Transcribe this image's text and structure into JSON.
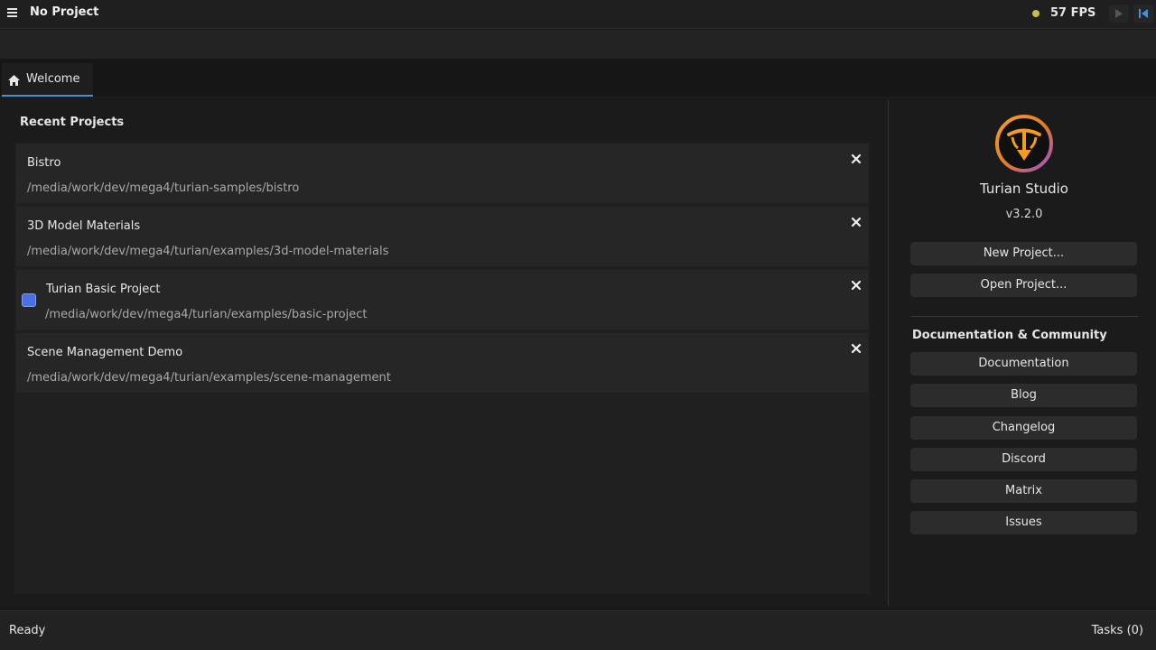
{
  "titlebar": {
    "project_title": "No Project",
    "fps": "57 FPS",
    "fps_dot_color": "#c9bd4a"
  },
  "tabs": [
    {
      "label": "Welcome",
      "icon": "home-icon",
      "active": true
    }
  ],
  "recent": {
    "header": "Recent Projects",
    "projects": [
      {
        "name": "Bistro",
        "path": "/media/work/dev/mega4/turian-samples/bistro",
        "selected": false
      },
      {
        "name": "3D Model Materials",
        "path": "/media/work/dev/mega4/turian/examples/3d-model-materials",
        "selected": false
      },
      {
        "name": "Turian Basic Project",
        "path": "/media/work/dev/mega4/turian/examples/basic-project",
        "selected": true
      },
      {
        "name": "Scene Management Demo",
        "path": "/media/work/dev/mega4/turian/examples/scene-management",
        "selected": false
      }
    ]
  },
  "app": {
    "name": "Turian Studio",
    "version": "v3.2.0"
  },
  "actions": {
    "new_project": "New Project...",
    "open_project": "Open Project..."
  },
  "docs": {
    "header": "Documentation & Community",
    "links": [
      "Documentation",
      "Blog",
      "Changelog",
      "Discord",
      "Matrix",
      "Issues"
    ]
  },
  "status": {
    "text": "Ready",
    "tasks": "Tasks (0)"
  },
  "colors": {
    "accent": "#4a8fd6",
    "checkbox": "#4a6fe0",
    "logo_orange": "#f39c1e",
    "logo_purple": "#9a4fd6"
  }
}
